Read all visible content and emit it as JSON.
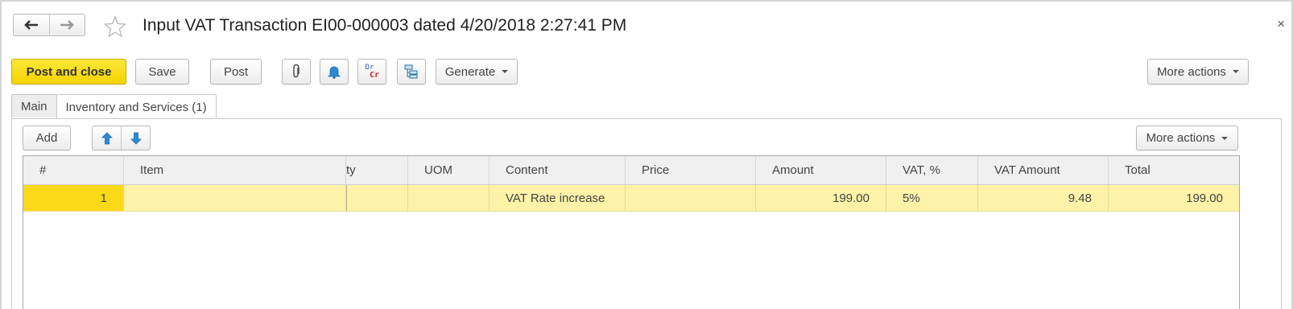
{
  "window": {
    "title": "Input VAT Transaction EI00-000003 dated 4/20/2018 2:27:41 PM",
    "close_glyph": "×",
    "nav_back_icon": "arrow-left-icon",
    "nav_forward_icon": "arrow-right-icon",
    "favorite_icon": "star-icon"
  },
  "toolbar": {
    "post_and_close": "Post and close",
    "save": "Save",
    "post": "Post",
    "attach_icon": "paperclip-icon",
    "reminder_icon": "bell-icon",
    "drcr_top": "Dr",
    "drcr_bottom": "Cr",
    "structure_icon": "hierarchy-icon",
    "generate": "Generate",
    "more_actions": "More actions"
  },
  "tabs": [
    {
      "label": "Main",
      "active": false
    },
    {
      "label": "Inventory and Services (1)",
      "active": true
    }
  ],
  "list_toolbar": {
    "add": "Add",
    "move_up_icon": "arrow-up-icon",
    "move_down_icon": "arrow-down-icon",
    "more_actions": "More actions"
  },
  "table": {
    "columns": [
      "#",
      "Item",
      "ty",
      "UOM",
      "Content",
      "Price",
      "Amount",
      "VAT, %",
      "VAT Amount",
      "Total"
    ],
    "rows": [
      [
        "1",
        "",
        "",
        "",
        "VAT Rate increase",
        "",
        "199.00",
        "5%",
        "9.48",
        "199.00"
      ]
    ]
  },
  "colors": {
    "primary_button": "#f5d400",
    "selected_row": "#fdf2a8",
    "selected_cell": "#fbd918",
    "accent_blue": "#2a8ad4",
    "drcr_red": "#cc2222"
  }
}
